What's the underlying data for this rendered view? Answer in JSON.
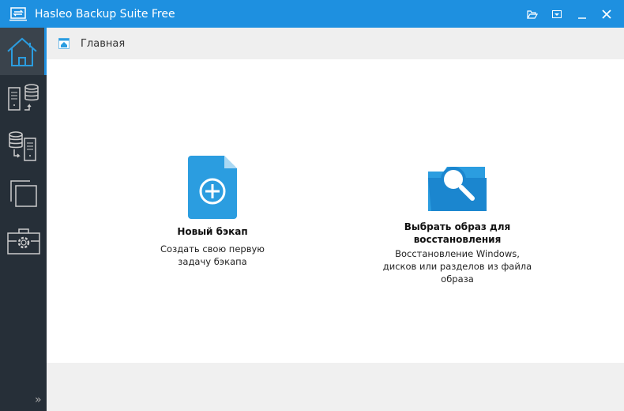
{
  "window": {
    "title": "Hasleo Backup Suite Free"
  },
  "breadcrumb": {
    "label": "Главная"
  },
  "sidebar": {
    "items": [
      {
        "name": "home"
      },
      {
        "name": "backup"
      },
      {
        "name": "restore"
      },
      {
        "name": "clone"
      },
      {
        "name": "tools"
      }
    ]
  },
  "actions": {
    "new_backup": {
      "title": "Новый бэкап",
      "description": "Создать свою первую задачу бэкапа"
    },
    "browse_image": {
      "title": "Выбрать образ для восстановления",
      "description": "Восстановление Windows, дисков или разделов из файла образа"
    }
  },
  "colors": {
    "accent": "#1e90e0",
    "sidebar": "#262f38",
    "icon": "#2b9de0"
  }
}
